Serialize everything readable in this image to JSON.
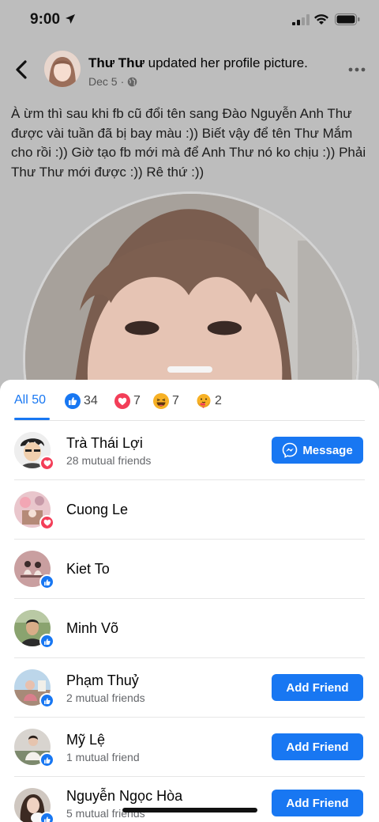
{
  "status": {
    "time": "9:00"
  },
  "post": {
    "author": "Thư Thư",
    "action": "updated her profile picture.",
    "date": "Dec 5",
    "text": "À ừm thì sau khi fb cũ đổi tên sang Đào Nguyễn Anh Thư được vài tuần đã bị bay màu :)) Biết vậy để tên Thư Mắm cho rồi :)) Giờ tạo fb mới mà để Anh Thư nó ko chịu :)) Phải Thư Thư mới được :)) Rê thứ :))"
  },
  "tabs": [
    {
      "label": "All 50",
      "icon": "none"
    },
    {
      "label": "34",
      "icon": "like-icon"
    },
    {
      "label": "7",
      "icon": "love-icon"
    },
    {
      "label": "7",
      "icon": "haha-icon"
    },
    {
      "label": "2",
      "icon": "care-icon"
    }
  ],
  "people": [
    {
      "name": "Trà Thái Lợi",
      "mutual": "28 mutual friends",
      "reaction": "love",
      "button": "Message"
    },
    {
      "name": "Cuong Le",
      "mutual": "",
      "reaction": "love",
      "button": ""
    },
    {
      "name": "Kiet To",
      "mutual": "",
      "reaction": "like",
      "button": ""
    },
    {
      "name": "Minh Võ",
      "mutual": "",
      "reaction": "like",
      "button": ""
    },
    {
      "name": "Phạm Thuỷ",
      "mutual": "2 mutual friends",
      "reaction": "like",
      "button": "Add Friend"
    },
    {
      "name": "Mỹ Lệ",
      "mutual": "1 mutual friend",
      "reaction": "like",
      "button": "Add Friend"
    },
    {
      "name": "Nguyễn Ngọc Hòa",
      "mutual": "5 mutual friends",
      "reaction": "like",
      "button": "Add Friend"
    }
  ],
  "colors": {
    "accent": "#1877f2",
    "love": "#f33e58",
    "haha": "#f7b125"
  }
}
